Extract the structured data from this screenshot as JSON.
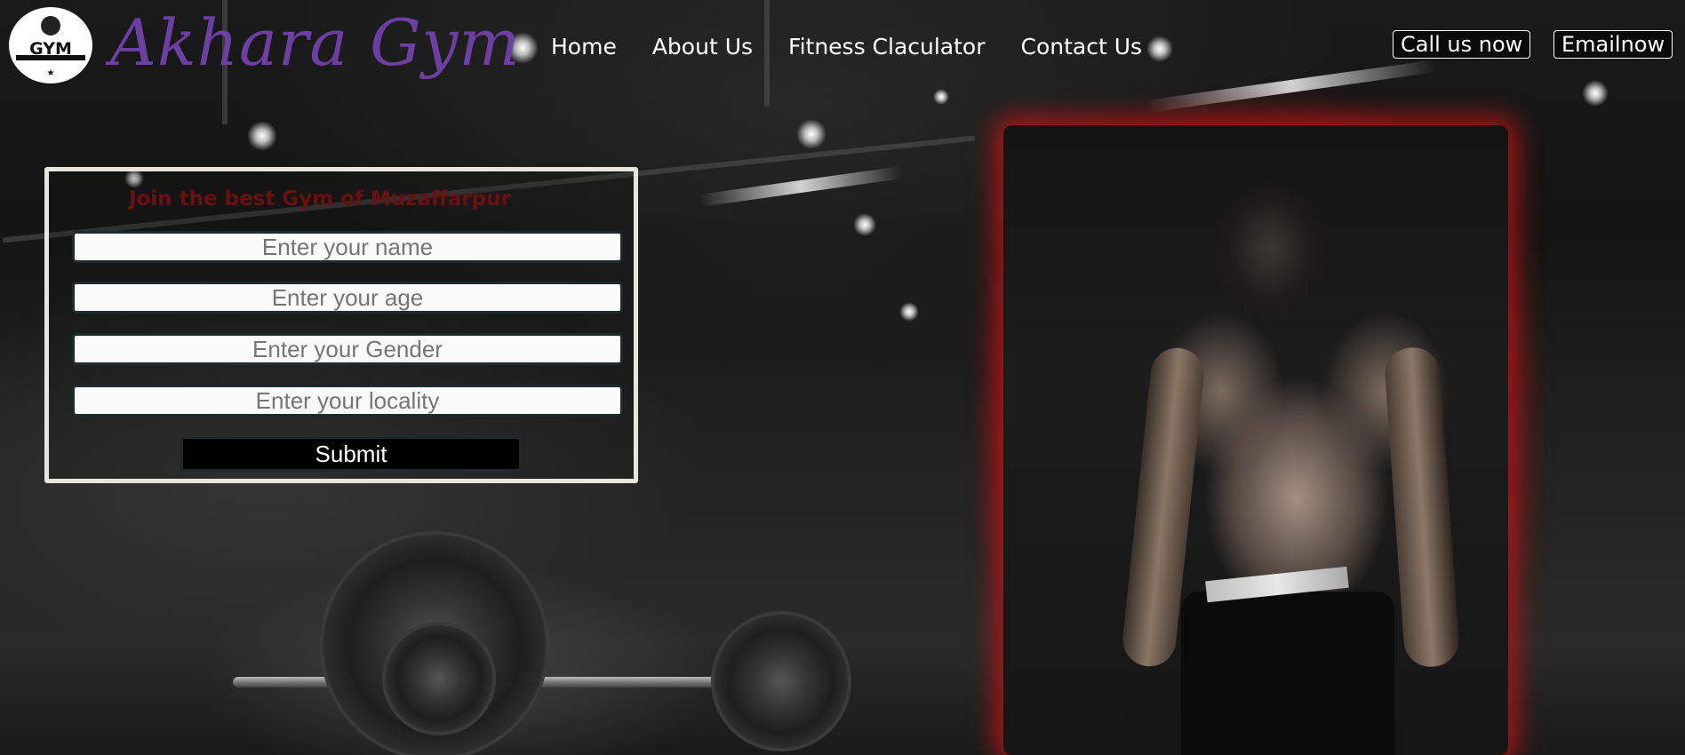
{
  "brand": {
    "logo_text": "GYM",
    "name": "Akhara Gym"
  },
  "nav": {
    "items": [
      "Home",
      "About Us",
      "Fitness Claculator",
      "Contact Us"
    ]
  },
  "cta": {
    "call": "Call us now",
    "email": "Emailnow"
  },
  "form": {
    "title": "Join the best Gym of Muzaffarpur",
    "fields": [
      {
        "placeholder": "Enter your name",
        "value": ""
      },
      {
        "placeholder": "Enter your age",
        "value": ""
      },
      {
        "placeholder": "Enter your Gender",
        "value": ""
      },
      {
        "placeholder": "Enter your locality",
        "value": ""
      }
    ],
    "submit_label": "Submit"
  },
  "colors": {
    "brand": "#6e3fa3",
    "form_title": "#6a1010",
    "hero_glow": "#d21414"
  }
}
